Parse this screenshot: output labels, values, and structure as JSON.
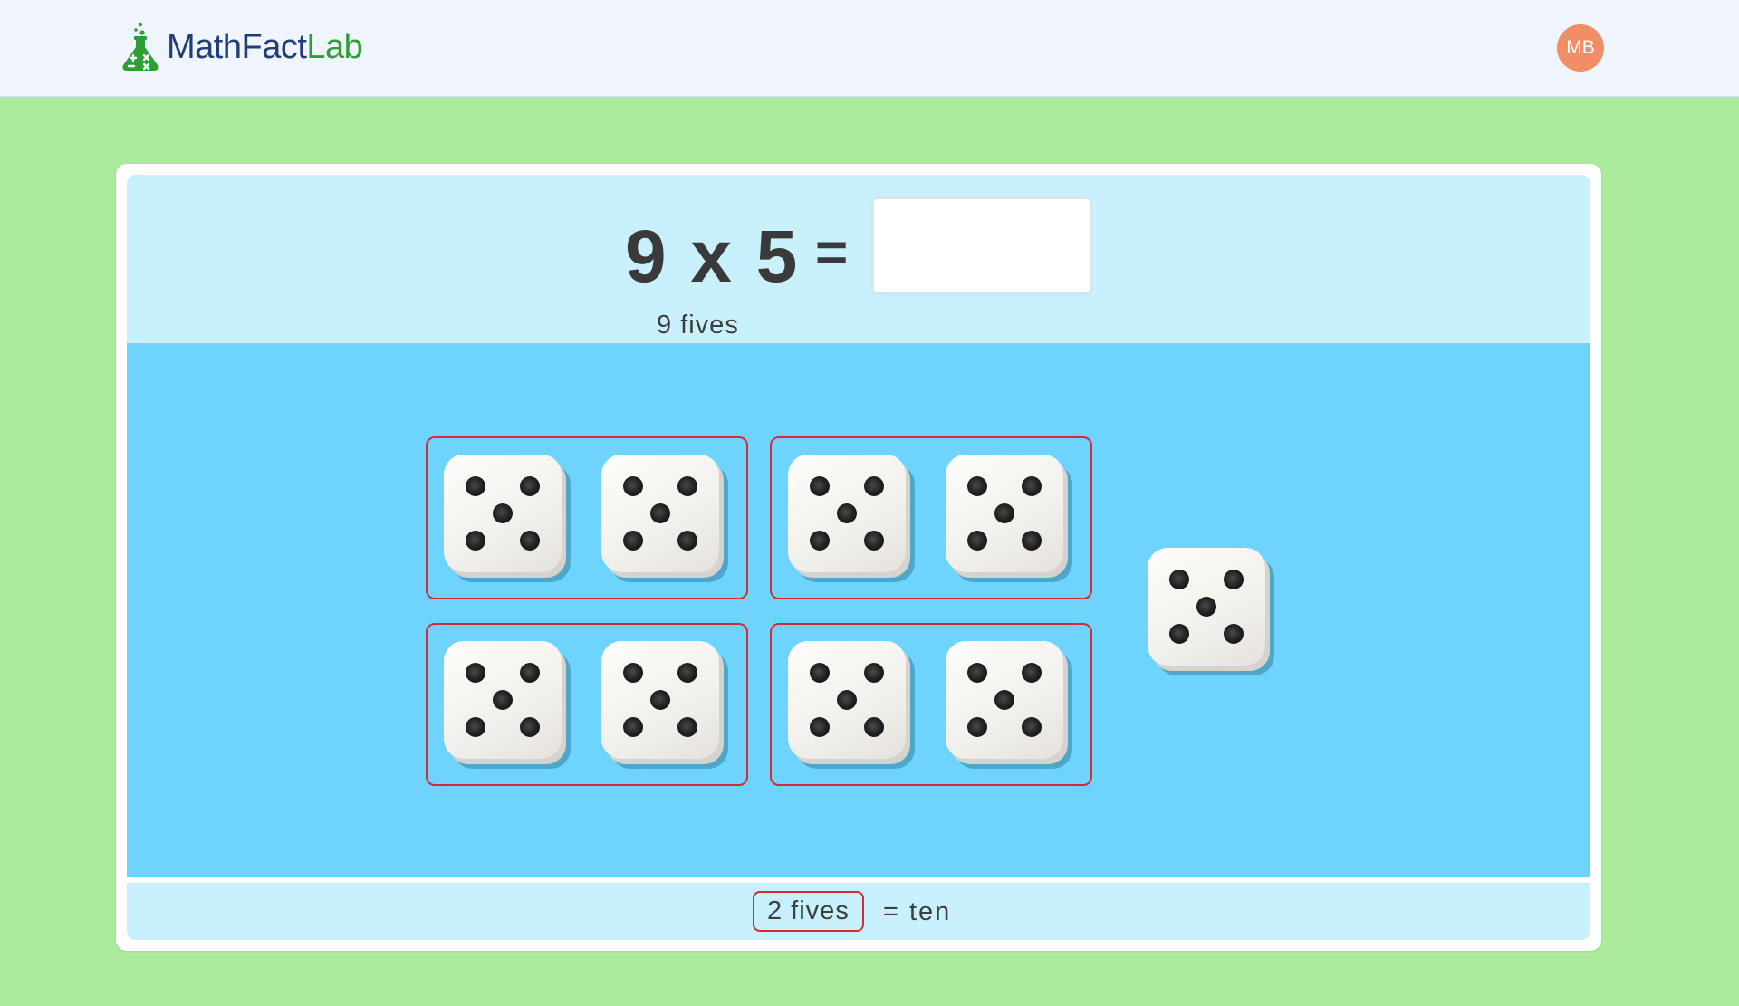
{
  "header": {
    "logo_part1": "MathFact",
    "logo_part2": "Lab",
    "logo_icon": "flask-icon",
    "avatar_initials": "MB",
    "colors": {
      "header_bg": "#eff4fd",
      "logo_dark": "#1f3f78",
      "logo_green": "#2e9f35",
      "avatar_bg": "#f28e66"
    }
  },
  "question": {
    "equation": "9 x 5",
    "equals": "=",
    "answer_value": "",
    "caption": "9 fives"
  },
  "array": {
    "dice_count": 9,
    "pips_per_die": 5,
    "groups": [
      {
        "dice": 2
      },
      {
        "dice": 2
      },
      {
        "dice": 2
      },
      {
        "dice": 2
      }
    ],
    "leftover_dice": 1,
    "colors": {
      "panel_bg": "#6ed4fd",
      "group_border": "#d42a35"
    }
  },
  "fact": {
    "pill_label": "2 fives",
    "result": "= ten"
  },
  "colors": {
    "page_bg": "#acea9e",
    "question_bg": "#c9f1fd"
  }
}
